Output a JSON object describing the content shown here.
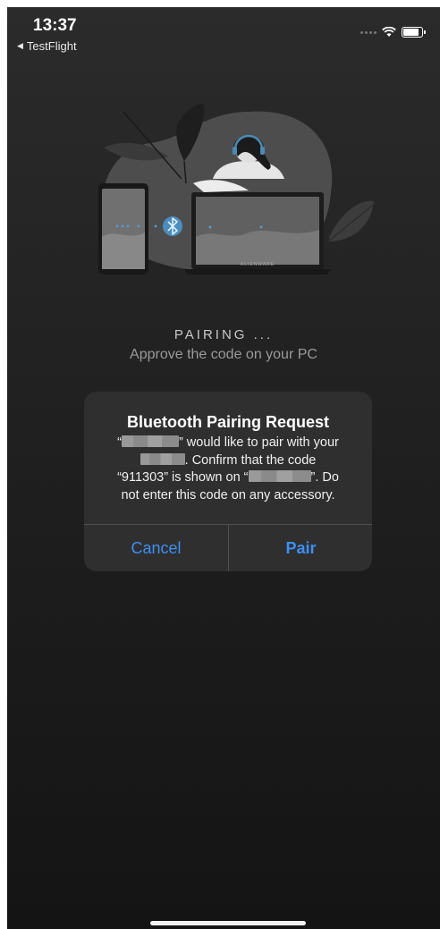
{
  "status_bar": {
    "time": "13:37",
    "back_label": "TestFlight",
    "icons": [
      "back-arrow-icon",
      "signal-icon",
      "wifi-icon",
      "battery-icon"
    ]
  },
  "pairing": {
    "title": "PAIRING ...",
    "subtitle": "Approve the code on your PC"
  },
  "illustration": {
    "laptop_brand": "ALIENWARE",
    "icons": [
      "phone-icon",
      "bluetooth-icon",
      "laptop-icon",
      "person-headphones-icon",
      "plant-leaf-icon"
    ]
  },
  "alert": {
    "title": "Bluetooth Pairing Request",
    "part1": "“",
    "part2": "” would like to pair with your",
    "part3": ". Confirm that the code",
    "part4": "“911303” is shown on “",
    "part5": "”. Do",
    "part6": "not enter this code on any accessory.",
    "code": "911303",
    "cancel_label": "Cancel",
    "pair_label": "Pair",
    "accent_color": "#3d8ff5"
  }
}
